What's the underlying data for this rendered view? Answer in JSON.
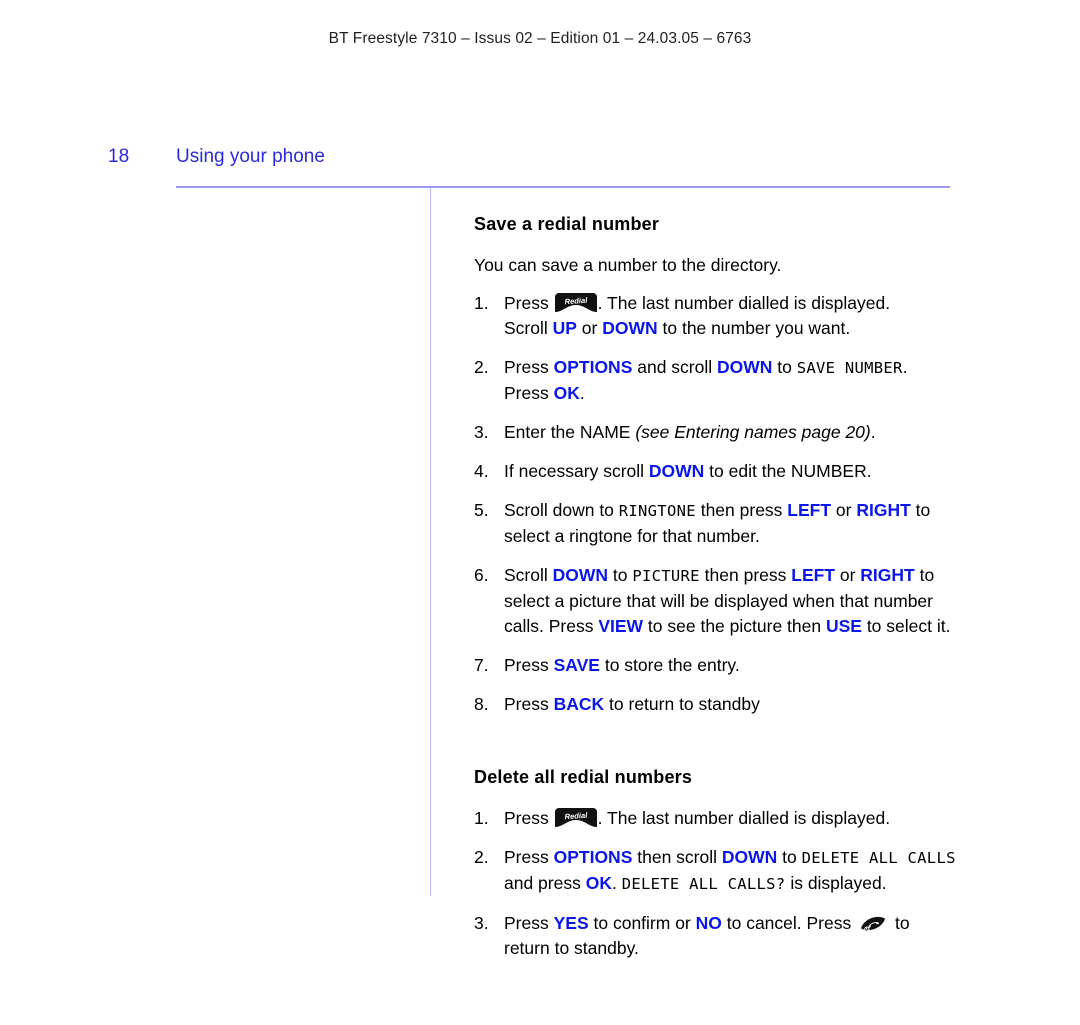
{
  "header": {
    "running_head": "BT Freestyle 7310 – Issus 02 – Edition 01 – 24.03.05 – 6763"
  },
  "page": {
    "number": "18",
    "section_title": "Using your phone"
  },
  "colors": {
    "title_blue": "#2a2ad8",
    "key_blue": "#0b16e8",
    "rule_blue": "#9a9aee"
  },
  "sections": [
    {
      "heading": "Save a redial number",
      "lead": "You can save a number to the directory.",
      "steps": [
        {
          "num": "1.",
          "parts": [
            {
              "t": "text",
              "v": "Press "
            },
            {
              "t": "icon",
              "v": "redial-key"
            },
            {
              "t": "text",
              "v": ". The last number dialled is displayed."
            },
            {
              "t": "br"
            },
            {
              "t": "text",
              "v": "Scroll "
            },
            {
              "t": "key",
              "v": "UP"
            },
            {
              "t": "text",
              "v": " or "
            },
            {
              "t": "key",
              "v": "DOWN"
            },
            {
              "t": "text",
              "v": " to the number you want."
            }
          ]
        },
        {
          "num": "2.",
          "parts": [
            {
              "t": "text",
              "v": "Press "
            },
            {
              "t": "key",
              "v": "OPTIONS"
            },
            {
              "t": "text",
              "v": " and scroll "
            },
            {
              "t": "key",
              "v": "DOWN"
            },
            {
              "t": "text",
              "v": " to "
            },
            {
              "t": "lcd",
              "v": "SAVE NUMBER"
            },
            {
              "t": "text",
              "v": "."
            },
            {
              "t": "br"
            },
            {
              "t": "text",
              "v": "Press "
            },
            {
              "t": "key",
              "v": "OK"
            },
            {
              "t": "text",
              "v": "."
            }
          ]
        },
        {
          "num": "3.",
          "parts": [
            {
              "t": "text",
              "v": "Enter the NAME "
            },
            {
              "t": "ital",
              "v": "(see Entering names page 20)"
            },
            {
              "t": "text",
              "v": "."
            }
          ]
        },
        {
          "num": "4.",
          "parts": [
            {
              "t": "text",
              "v": "If necessary scroll "
            },
            {
              "t": "key",
              "v": "DOWN"
            },
            {
              "t": "text",
              "v": " to edit the NUMBER."
            }
          ]
        },
        {
          "num": "5.",
          "parts": [
            {
              "t": "text",
              "v": "Scroll down to "
            },
            {
              "t": "lcd",
              "v": "RINGTONE"
            },
            {
              "t": "text",
              "v": " then press "
            },
            {
              "t": "key",
              "v": "LEFT"
            },
            {
              "t": "text",
              "v": " or "
            },
            {
              "t": "key",
              "v": "RIGHT"
            },
            {
              "t": "text",
              "v": " to"
            },
            {
              "t": "br"
            },
            {
              "t": "text",
              "v": "select a ringtone for that number."
            }
          ]
        },
        {
          "num": "6.",
          "parts": [
            {
              "t": "text",
              "v": "Scroll "
            },
            {
              "t": "key",
              "v": "DOWN"
            },
            {
              "t": "text",
              "v": " to "
            },
            {
              "t": "lcd",
              "v": "PICTURE"
            },
            {
              "t": "text",
              "v": " then press "
            },
            {
              "t": "key",
              "v": "LEFT"
            },
            {
              "t": "text",
              "v": " or "
            },
            {
              "t": "key",
              "v": "RIGHT"
            },
            {
              "t": "text",
              "v": " to"
            },
            {
              "t": "br"
            },
            {
              "t": "text",
              "v": "select a picture that will be displayed when that number"
            },
            {
              "t": "br"
            },
            {
              "t": "text",
              "v": "calls. Press "
            },
            {
              "t": "key",
              "v": "VIEW"
            },
            {
              "t": "text",
              "v": " to see the picture then "
            },
            {
              "t": "key",
              "v": "USE"
            },
            {
              "t": "text",
              "v": " to select it."
            }
          ]
        },
        {
          "num": "7.",
          "parts": [
            {
              "t": "text",
              "v": "Press "
            },
            {
              "t": "key",
              "v": "SAVE"
            },
            {
              "t": "text",
              "v": " to store the entry."
            }
          ]
        },
        {
          "num": "8.",
          "parts": [
            {
              "t": "text",
              "v": "Press "
            },
            {
              "t": "key",
              "v": "BACK"
            },
            {
              "t": "text",
              "v": " to return to standby"
            }
          ]
        }
      ]
    },
    {
      "heading": "Delete all redial numbers",
      "lead": "",
      "steps": [
        {
          "num": "1.",
          "parts": [
            {
              "t": "text",
              "v": "Press "
            },
            {
              "t": "icon",
              "v": "redial-key"
            },
            {
              "t": "text",
              "v": ". The last number dialled is displayed."
            }
          ]
        },
        {
          "num": "2.",
          "parts": [
            {
              "t": "text",
              "v": "Press "
            },
            {
              "t": "key",
              "v": "OPTIONS"
            },
            {
              "t": "text",
              "v": " then scroll "
            },
            {
              "t": "key",
              "v": "DOWN"
            },
            {
              "t": "text",
              "v": " to "
            },
            {
              "t": "lcd",
              "v": "DELETE ALL CALLS"
            },
            {
              "t": "br"
            },
            {
              "t": "text",
              "v": "and press "
            },
            {
              "t": "key",
              "v": "OK"
            },
            {
              "t": "text",
              "v": ". "
            },
            {
              "t": "lcd",
              "v": "DELETE ALL CALLS?"
            },
            {
              "t": "text",
              "v": " is displayed."
            }
          ]
        },
        {
          "num": "3.",
          "parts": [
            {
              "t": "text",
              "v": "Press "
            },
            {
              "t": "key",
              "v": "YES"
            },
            {
              "t": "text",
              "v": " to confirm or "
            },
            {
              "t": "key",
              "v": "NO"
            },
            {
              "t": "text",
              "v": " to cancel. Press "
            },
            {
              "t": "icon",
              "v": "end-call-key"
            },
            {
              "t": "text",
              "v": " to"
            },
            {
              "t": "br"
            },
            {
              "t": "text",
              "v": "return to standby."
            }
          ]
        }
      ]
    }
  ],
  "icons": {
    "redial-key": {
      "label": "Redial"
    },
    "end-call-key": {
      "label": "end call"
    }
  }
}
